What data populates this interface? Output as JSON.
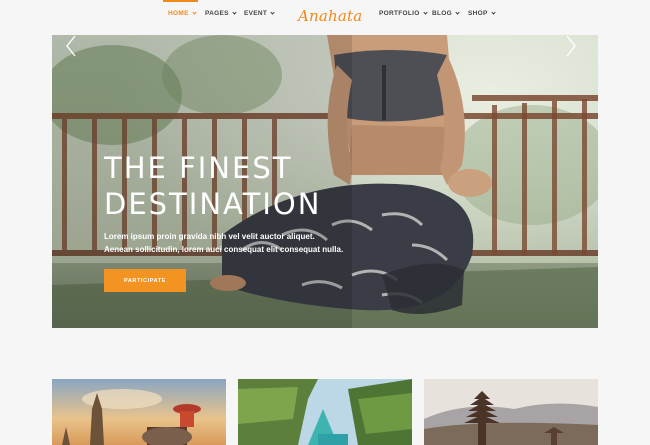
{
  "nav": {
    "left": [
      {
        "label": "HOME",
        "has_dropdown": true,
        "active": true
      },
      {
        "label": "PAGES",
        "has_dropdown": true,
        "active": false
      },
      {
        "label": "EVENT",
        "has_dropdown": true,
        "active": false
      }
    ],
    "logo": "Anahata",
    "right": [
      {
        "label": "PORTFOLIO",
        "has_dropdown": true
      },
      {
        "label": "BLOG",
        "has_dropdown": true
      },
      {
        "label": "SHOP",
        "has_dropdown": true
      }
    ]
  },
  "hero": {
    "title_line1": "THE FINEST",
    "title_line2": "DESTINATION",
    "subtitle_line1": "Lorem ipsum proin gravida nibh vel velit auctor aliquet.",
    "subtitle_line2": "Aenean sollicitudin, lorem auci consequat elit consequat nulla.",
    "button_label": "PARTICIPATE",
    "prev_icon": "chevron-left-icon",
    "next_icon": "chevron-right-icon"
  },
  "cards": [
    {
      "image": "asian-temple-elephant-sunset"
    },
    {
      "image": "tropical-lagoon-cliffs"
    },
    {
      "image": "balinese-pagoda-temple"
    }
  ],
  "colors": {
    "accent": "#f08a1c",
    "button": "#f39422",
    "background": "#f6f6f6"
  }
}
